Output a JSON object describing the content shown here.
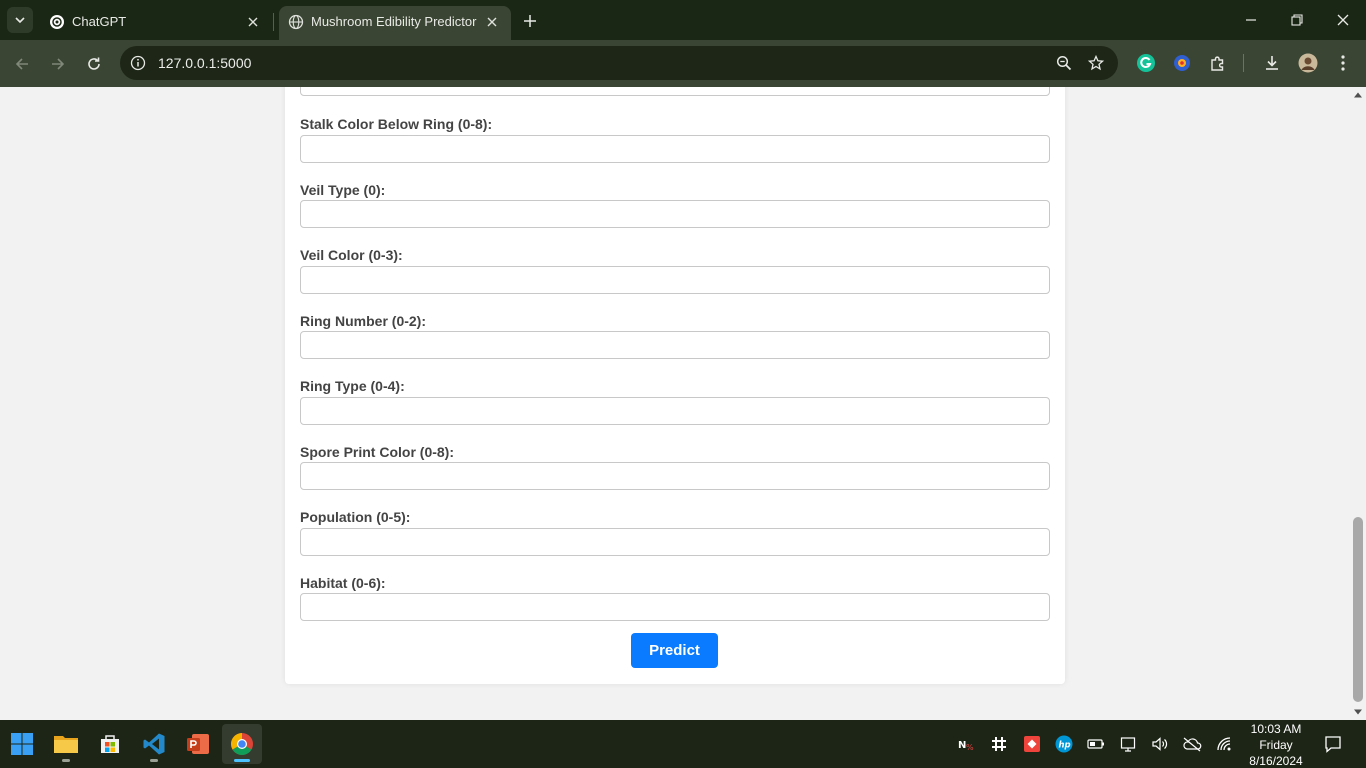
{
  "browser": {
    "tabs": [
      {
        "title": "ChatGPT",
        "active": false
      },
      {
        "title": "Mushroom Edibility Predictor",
        "active": true
      }
    ],
    "url": "127.0.0.1:5000"
  },
  "form": {
    "fields": [
      {
        "label": "Stalk Color Below Ring (0-8):",
        "value": ""
      },
      {
        "label": "Veil Type (0):",
        "value": ""
      },
      {
        "label": "Veil Color (0-3):",
        "value": ""
      },
      {
        "label": "Ring Number (0-2):",
        "value": ""
      },
      {
        "label": "Ring Type (0-4):",
        "value": ""
      },
      {
        "label": "Spore Print Color (0-8):",
        "value": ""
      },
      {
        "label": "Population (0-5):",
        "value": ""
      },
      {
        "label": "Habitat (0-6):",
        "value": ""
      }
    ],
    "submit_label": "Predict"
  },
  "taskbar": {
    "apps": [
      "start-icon",
      "file-explorer-icon",
      "microsoft-store-icon",
      "vscode-icon",
      "powerpoint-icon",
      "chrome-icon"
    ],
    "clock": {
      "time": "10:03 AM",
      "day": "Friday",
      "date": "8/16/2024"
    }
  },
  "colors": {
    "tabstrip": "#1b2715",
    "toolbar": "#3b4533",
    "button": "#0a7bff",
    "taskbar": "#1d2616"
  }
}
